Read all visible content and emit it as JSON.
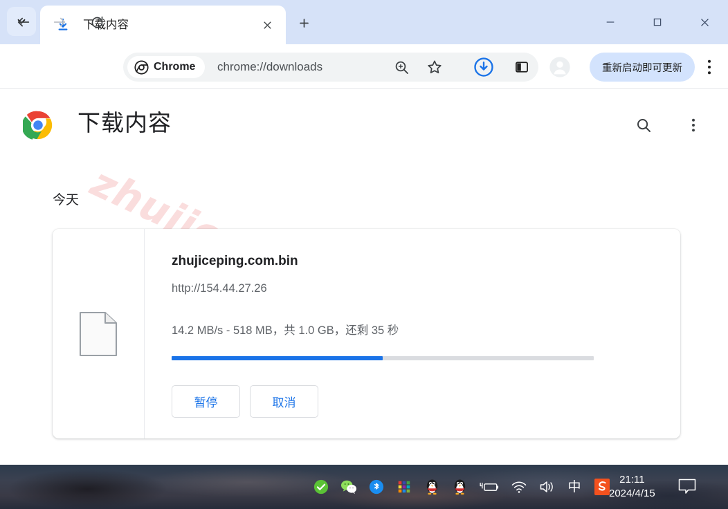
{
  "window": {
    "tab_search_icon": "chevron-down-icon",
    "minimize_label": "—",
    "maximize_label": "□",
    "close_label": "✕"
  },
  "tab": {
    "title": "下载内容",
    "favicon": "download-icon",
    "close_icon": "close-icon",
    "new_tab_icon": "plus-icon"
  },
  "toolbar": {
    "back_icon": "back-arrow-icon",
    "forward_icon": "forward-arrow-icon",
    "reload_icon": "reload-icon",
    "chrome_chip_label": "Chrome",
    "url": "chrome://downloads",
    "zoom_icon": "zoom-in-icon",
    "bookmark_icon": "star-icon",
    "downloads_icon": "download-circle-icon",
    "side_panel_icon": "side-panel-icon",
    "profile_icon": "avatar-icon",
    "update_label": "重新启动即可更新",
    "menu_icon": "three-dot-menu-icon"
  },
  "page": {
    "logo": "chrome-logo",
    "title": "下载内容",
    "search_icon": "search-icon",
    "menu_icon": "three-dot-menu-icon",
    "watermark": "zhujiceping.com",
    "section_label": "今天"
  },
  "download": {
    "file_icon": "file-document-icon",
    "filename": "zhujiceping.com.bin",
    "url": "http://154.44.27.26",
    "status": "14.2 MB/s - 518 MB，共 1.0 GB，还剩 35 秒",
    "progress_percent": 50,
    "progress_color": "#1a73e8",
    "pause_label": "暂停",
    "cancel_label": "取消"
  },
  "taskbar": {
    "tray_icons": [
      "green-check-icon",
      "wechat-icon",
      "bluetooth-icon",
      "color-grid-icon",
      "qq-penguin-icon",
      "qq-penguin-icon",
      "battery-charging-icon",
      "wifi-icon",
      "volume-icon"
    ],
    "ime_label": "中",
    "sogou_icon": "sogou-icon",
    "time": "21:11",
    "date": "2024/4/15",
    "notification_icon": "notification-bubble-icon"
  }
}
